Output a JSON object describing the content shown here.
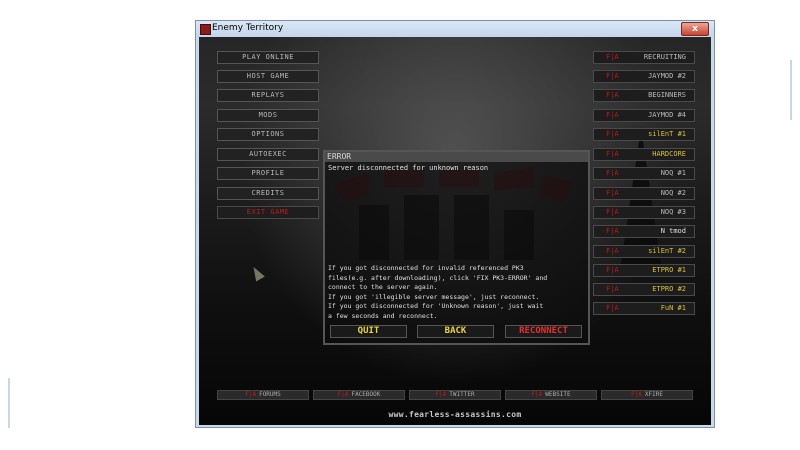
{
  "window": {
    "title": "Enemy Territory",
    "close_label": "x"
  },
  "menu": {
    "items": [
      {
        "label": "PLAY ONLINE"
      },
      {
        "label": "HOST GAME"
      },
      {
        "label": "REPLAYS"
      },
      {
        "label": "MODS"
      },
      {
        "label": "OPTIONS"
      },
      {
        "label": "AUTOEXEC"
      },
      {
        "label": "PROFILE"
      },
      {
        "label": "CREDITS"
      },
      {
        "label": "EXIT GAME"
      }
    ]
  },
  "servers": {
    "tag": "F|A",
    "items": [
      {
        "name": "RECRUITING",
        "color": "#b9b9b9"
      },
      {
        "name": "JAYMOD #2",
        "color": "#b9b9b9"
      },
      {
        "name": "BEGINNERS",
        "color": "#b9b9b9"
      },
      {
        "name": "JAYMOD #4",
        "color": "#b9b9b9"
      },
      {
        "name": "silEnT #1",
        "color": "#d8c23a"
      },
      {
        "name": "HARDCORE",
        "color": "#d8c23a"
      },
      {
        "name": "NOQ #1",
        "color": "#b9b9b9"
      },
      {
        "name": "NOQ #2",
        "color": "#b9b9b9"
      },
      {
        "name": "NOQ #3",
        "color": "#b9b9b9"
      },
      {
        "name": "N tmod",
        "color": "#e0e0e0"
      },
      {
        "name": "silEnT #2",
        "color": "#d8c23a"
      },
      {
        "name": "ETPRO #1",
        "color": "#d8c23a"
      },
      {
        "name": "ETPRO #2",
        "color": "#d8c23a"
      },
      {
        "name": "FuN #1",
        "color": "#d8c23a"
      }
    ]
  },
  "dialog": {
    "title": "ERROR",
    "message": "Server disconnected for unknown reason",
    "help_lines": [
      "If you got disconnected for invalid referenced PK3",
      "files(e.g. after downloading), click 'FIX PK3-ERROR' and",
      "connect to the server again.",
      "If you got 'illegible server message', just reconnect.",
      "If you got disconnected for 'Unknown reason', just wait",
      "a few seconds and reconnect."
    ],
    "buttons": {
      "quit": "QUIT",
      "back": "BACK",
      "reconnect": "RECONNECT"
    }
  },
  "links": [
    {
      "tag": "F|A",
      "label": "FORUMS"
    },
    {
      "tag": "F|A",
      "label": "FACEBOOK"
    },
    {
      "tag": "F|A",
      "label": "TWITTER"
    },
    {
      "tag": "F|A",
      "label": "WEBSITE"
    },
    {
      "tag": "F|A",
      "label": "XFIRE"
    }
  ],
  "footer": {
    "url": "www.fearless-assassins.com"
  },
  "colors": {
    "accent_red": "#c11a1a",
    "highlight_yellow": "#e8d44a"
  }
}
